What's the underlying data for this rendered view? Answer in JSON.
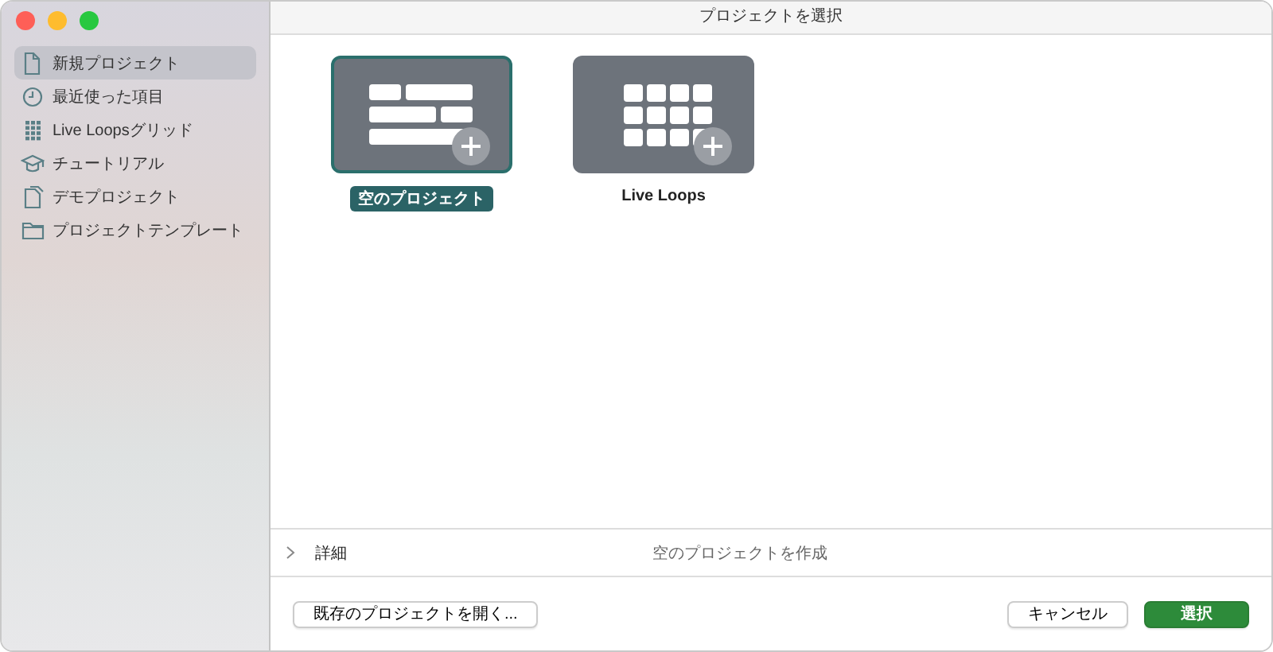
{
  "window": {
    "title": "プロジェクトを選択"
  },
  "sidebar": {
    "items": [
      {
        "label": "新規プロジェクト",
        "kind": "document",
        "selected": true
      },
      {
        "label": "最近使った項目",
        "kind": "clock",
        "selected": false
      },
      {
        "label": "Live Loopsグリッド",
        "kind": "grid",
        "selected": false
      },
      {
        "label": "チュートリアル",
        "kind": "cap",
        "selected": false
      },
      {
        "label": "デモプロジェクト",
        "kind": "demo",
        "selected": false
      },
      {
        "label": "プロジェクトテンプレート",
        "kind": "folder",
        "selected": false
      }
    ]
  },
  "templates": [
    {
      "label": "空のプロジェクト",
      "kind": "tracks",
      "selected": true
    },
    {
      "label": "Live Loops",
      "kind": "grid",
      "selected": false
    }
  ],
  "details": {
    "label": "詳細",
    "expanded": false,
    "description": "空のプロジェクトを作成"
  },
  "buttons": {
    "open": "既存のプロジェクトを開く...",
    "cancel": "キャンセル",
    "choose": "選択"
  }
}
